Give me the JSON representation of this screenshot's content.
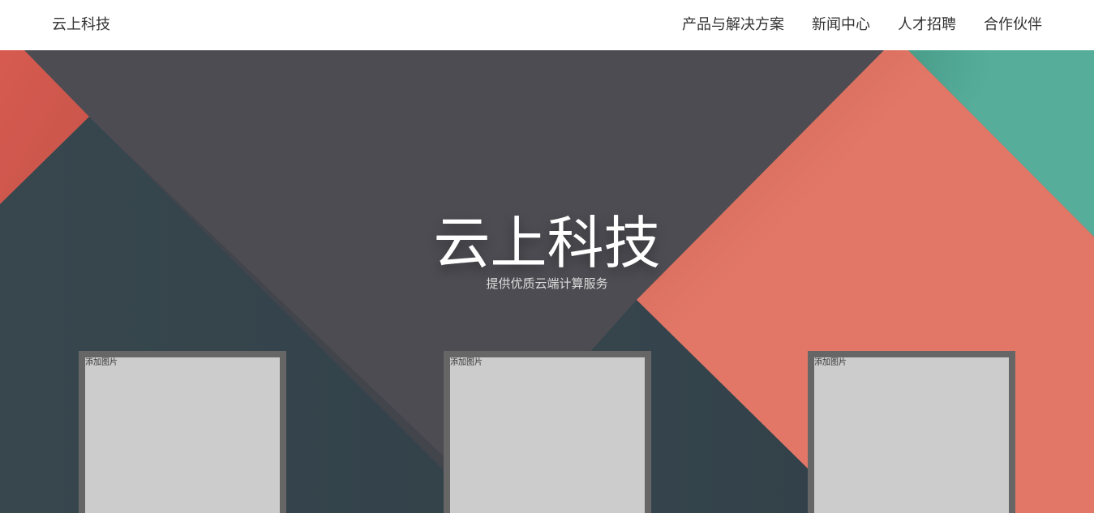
{
  "navbar": {
    "brand": "云上科技",
    "links": [
      "产品与解决方案",
      "新闻中心",
      "人才招聘",
      "合作伙伴"
    ]
  },
  "hero": {
    "title": "云上科技",
    "subtitle": "提供优质云端计算服务"
  },
  "cards": [
    {
      "label": "添加图片"
    },
    {
      "label": "添加图片"
    },
    {
      "label": "添加图片"
    }
  ],
  "colors": {
    "slate": "#38474e",
    "charcoal": "#4d4c52",
    "coral": "#e27767",
    "red": "#d65a50",
    "teal": "#56ae9a",
    "card_frame": "#666666",
    "card_fill": "#cccccc"
  }
}
